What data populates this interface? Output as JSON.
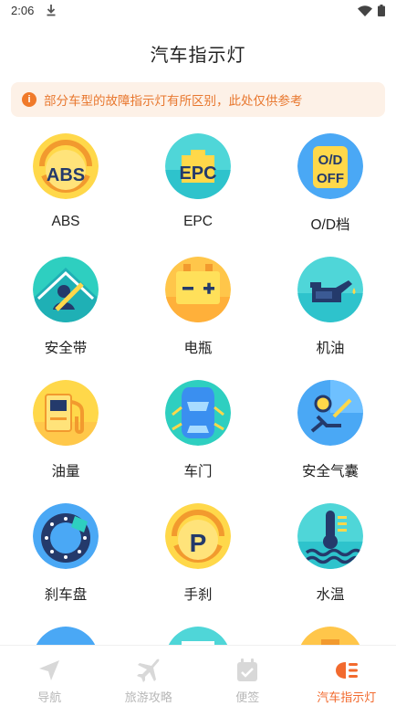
{
  "status_bar": {
    "time": "2:06"
  },
  "page_title": "汽车指示灯",
  "notice": {
    "text": "部分车型的故障指示灯有所区别，此处仅供参考"
  },
  "indicators": [
    {
      "label": "ABS",
      "icon": "abs-icon"
    },
    {
      "label": "EPC",
      "icon": "epc-icon"
    },
    {
      "label": "O/D档",
      "icon": "od-off-icon"
    },
    {
      "label": "安全带",
      "icon": "seatbelt-icon"
    },
    {
      "label": "电瓶",
      "icon": "battery-icon"
    },
    {
      "label": "机油",
      "icon": "oil-can-icon"
    },
    {
      "label": "油量",
      "icon": "fuel-pump-icon"
    },
    {
      "label": "车门",
      "icon": "car-door-icon"
    },
    {
      "label": "安全气囊",
      "icon": "airbag-icon"
    },
    {
      "label": "刹车盘",
      "icon": "brake-disc-icon"
    },
    {
      "label": "手刹",
      "icon": "handbrake-icon"
    },
    {
      "label": "水温",
      "icon": "water-temp-icon"
    }
  ],
  "icon_texts": {
    "abs": "ABS",
    "epc": "EPC",
    "od_top": "O/D",
    "od_bottom": "OFF",
    "park": "P"
  },
  "tabs": [
    {
      "label": "导航",
      "icon": "navigation-icon",
      "active": false
    },
    {
      "label": "旅游攻略",
      "icon": "airplane-icon",
      "active": false
    },
    {
      "label": "便签",
      "icon": "calendar-check-icon",
      "active": false
    },
    {
      "label": "汽车指示灯",
      "icon": "headlight-icon",
      "active": true
    }
  ],
  "colors": {
    "accent": "#f26a2e",
    "notice_bg": "#fdf1e7",
    "notice_text": "#e8772e",
    "tab_inactive": "#b8b8b8"
  }
}
